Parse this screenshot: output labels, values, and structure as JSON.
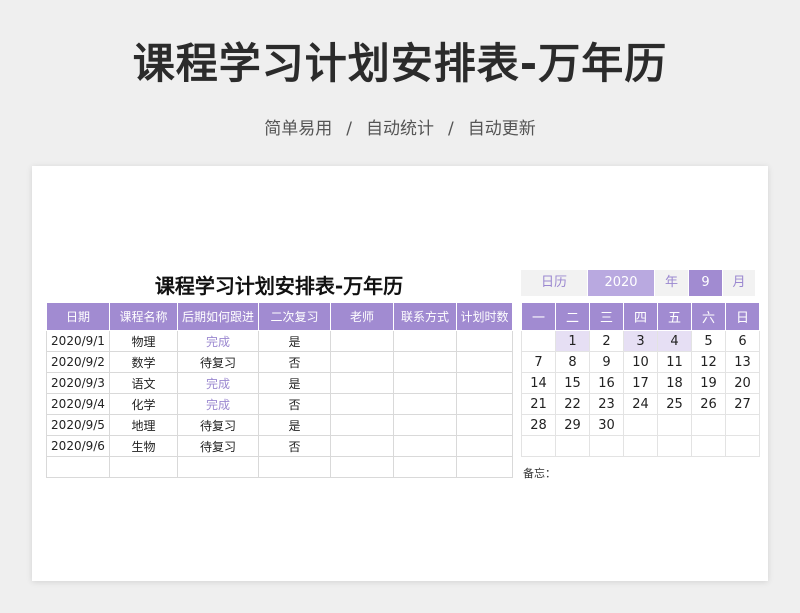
{
  "hero": {
    "title": "课程学习计划安排表-万年历",
    "features": [
      "简单易用",
      "自动统计",
      "自动更新"
    ],
    "separator": "/"
  },
  "sheet": {
    "title": "课程学习计划安排表-万年历",
    "columns": [
      "日期",
      "课程名称",
      "后期如何跟进",
      "二次复习",
      "老师",
      "联系方式",
      "计划时数"
    ],
    "rows": [
      {
        "date": "2020/9/1",
        "course": "物理",
        "followup": "完成",
        "review": "是",
        "teacher": "",
        "contact": "",
        "hours": ""
      },
      {
        "date": "2020/9/2",
        "course": "数学",
        "followup": "待复习",
        "review": "否",
        "teacher": "",
        "contact": "",
        "hours": ""
      },
      {
        "date": "2020/9/3",
        "course": "语文",
        "followup": "完成",
        "review": "是",
        "teacher": "",
        "contact": "",
        "hours": ""
      },
      {
        "date": "2020/9/4",
        "course": "化学",
        "followup": "完成",
        "review": "否",
        "teacher": "",
        "contact": "",
        "hours": ""
      },
      {
        "date": "2020/9/5",
        "course": "地理",
        "followup": "待复习",
        "review": "是",
        "teacher": "",
        "contact": "",
        "hours": ""
      },
      {
        "date": "2020/9/6",
        "course": "生物",
        "followup": "待复习",
        "review": "否",
        "teacher": "",
        "contact": "",
        "hours": ""
      }
    ]
  },
  "calendar": {
    "label": "日历",
    "year": "2020",
    "year_unit": "年",
    "month": "9",
    "month_unit": "月",
    "weekdays": [
      "一",
      "二",
      "三",
      "四",
      "五",
      "六",
      "日"
    ],
    "weeks": [
      [
        "",
        "1",
        "2",
        "3",
        "4",
        "5",
        "6"
      ],
      [
        "7",
        "8",
        "9",
        "10",
        "11",
        "12",
        "13"
      ],
      [
        "14",
        "15",
        "16",
        "17",
        "18",
        "19",
        "20"
      ],
      [
        "21",
        "22",
        "23",
        "24",
        "25",
        "26",
        "27"
      ],
      [
        "28",
        "29",
        "30",
        "",
        "",
        "",
        ""
      ]
    ],
    "highlighted_days": [
      "1",
      "3",
      "4"
    ],
    "memo_label": "备忘："
  },
  "colors": {
    "accent": "#a18bd1",
    "accent_light": "#e6dff4",
    "done_text": "#9b88d0",
    "page_bg": "#efefef"
  }
}
